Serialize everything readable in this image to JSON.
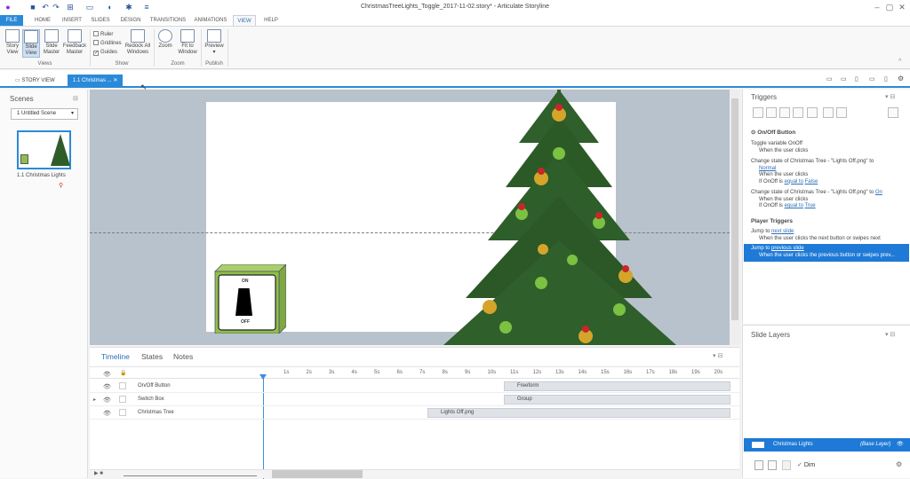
{
  "window": {
    "title": "ChristmasTreeLights_Toggle_2017-11-02.story* - Articulate Storyline"
  },
  "tabs": [
    "FILE",
    "HOME",
    "INSERT",
    "SLIDES",
    "DESIGN",
    "TRANSITIONS",
    "ANIMATIONS",
    "VIEW",
    "HELP"
  ],
  "ribbon": {
    "story_view": "Story View",
    "slide_view": "Slide View",
    "slide_master": "Slide Master",
    "feedback_master": "Feedback Master",
    "views_group": "Views",
    "ruler": "Ruler",
    "gridlines": "Gridlines",
    "guides": "Guides",
    "redock": "Redock All Windows",
    "show_group": "Show",
    "zoom": "Zoom",
    "fit": "Fit to Window",
    "zoom_group": "Zoom",
    "preview": "Preview",
    "preview_arrow": "▾",
    "publish_group": "Publish"
  },
  "viewbar": {
    "story_view": "STORY VIEW",
    "slide_tab": "1.1 Christmas ..."
  },
  "scenes": {
    "header": "Scenes",
    "dropdown": "1 Untitled Scene",
    "thumb_label": "1.1 Christmas Lights"
  },
  "switch": {
    "on": "ON",
    "off": "OFF"
  },
  "timeline": {
    "tabs": [
      "Timeline",
      "States",
      "Notes"
    ],
    "ticks": [
      "1s",
      "2s",
      "3s",
      "4s",
      "5s",
      "6s",
      "7s",
      "8s",
      "9s",
      "10s",
      "11s",
      "12s",
      "13s",
      "14s",
      "15s",
      "16s",
      "17s",
      "18s",
      "19s",
      "20s"
    ],
    "rows": [
      {
        "name": "On/Off Button",
        "bar": "Freeform"
      },
      {
        "name": "Switch Box",
        "bar": "Group"
      },
      {
        "name": "Christmas Tree",
        "bar": "Lights Off.png"
      }
    ]
  },
  "triggers": {
    "header": "Triggers",
    "section": "On/Off Button",
    "t1": "Toggle variable OnOff",
    "t1_when": "When the user clicks",
    "t2_pre": "Change state of Christmas Tree - \"Lights Off.png\" to",
    "t2_link": "Normal",
    "t2_when": "When the user clicks",
    "t2_if": "If OnOff is",
    "t2_cond": "equal to",
    "t2_val": "False",
    "t3_pre": "Change state of Christmas Tree - \"Lights Off.png\" to",
    "t3_link": "On",
    "t3_when": "When the user clicks",
    "t3_if": "If OnOff is",
    "t3_cond": "equal to",
    "t3_val": "True",
    "player_header": "Player Triggers",
    "p1_pre": "Jump to",
    "p1_link": "next slide",
    "p1_when": "When the user clicks the next button or swipes next",
    "p2_pre": "Jump to",
    "p2_link": "previous slide",
    "p2_when": "When the user clicks the previous button or swipes prev..."
  },
  "layers": {
    "header": "Slide Layers",
    "base_name": "Christmas Lights",
    "base_tag": "(Base Layer)",
    "dim": "Dim"
  },
  "colors": {
    "accent": "#2b8ad8",
    "selected_row": "#1e7ad6",
    "switch_green": "#8fbf4a"
  }
}
